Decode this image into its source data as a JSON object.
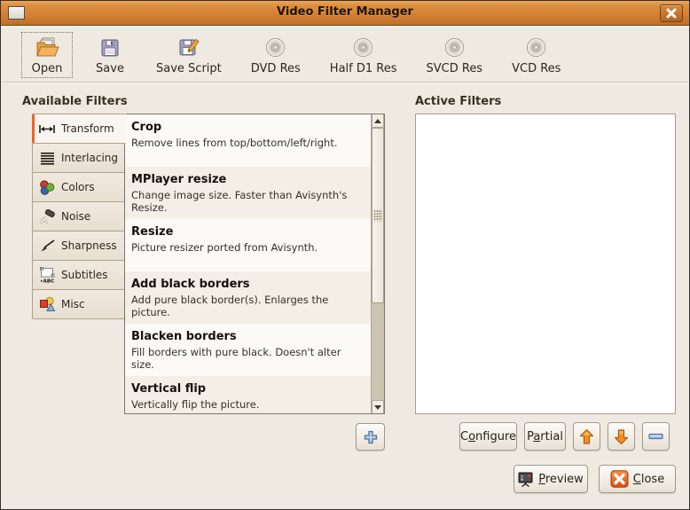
{
  "window": {
    "title": "Video Filter Manager",
    "icon": "window-shade-icon",
    "close_icon": "close-x-icon"
  },
  "toolbar": {
    "items": [
      {
        "label": "Open",
        "icon": "open-folder-icon",
        "focused": true
      },
      {
        "label": "Save",
        "icon": "floppy-disk-icon"
      },
      {
        "label": "Save Script",
        "icon": "floppy-pencil-icon"
      },
      {
        "label": "DVD Res",
        "icon": "disc-icon"
      },
      {
        "label": "Half D1 Res",
        "icon": "disc-icon"
      },
      {
        "label": "SVCD Res",
        "icon": "disc-icon"
      },
      {
        "label": "VCD Res",
        "icon": "disc-icon"
      }
    ]
  },
  "available": {
    "heading": "Available Filters",
    "tabs": [
      {
        "label": "Transform",
        "icon": "transform-icon",
        "selected": true
      },
      {
        "label": "Interlacing",
        "icon": "interlacing-icon"
      },
      {
        "label": "Colors",
        "icon": "colors-icon"
      },
      {
        "label": "Noise",
        "icon": "noise-icon"
      },
      {
        "label": "Sharpness",
        "icon": "sharpness-icon"
      },
      {
        "label": "Subtitles",
        "icon": "subtitles-icon"
      },
      {
        "label": "Misc",
        "icon": "misc-icon"
      }
    ],
    "filters": [
      {
        "name": "Crop",
        "desc": "Remove lines from top/bottom/left/right."
      },
      {
        "name": "MPlayer resize",
        "desc": "Change image size. Faster than Avisynth's Resize."
      },
      {
        "name": "Resize",
        "desc": "Picture resizer ported from Avisynth."
      },
      {
        "name": "Add black borders",
        "desc": "Add pure black border(s). Enlarges the picture."
      },
      {
        "name": "Blacken borders",
        "desc": "Fill borders with pure black. Doesn't alter size."
      },
      {
        "name": "Vertical flip",
        "desc": "Vertically flip the picture."
      }
    ]
  },
  "active": {
    "heading": "Active Filters",
    "items": []
  },
  "buttons": {
    "add_icon": "plus-icon",
    "configure": {
      "pre": "C",
      "mn": "o",
      "post": "nfigure"
    },
    "partial": {
      "pre": "P",
      "mn": "a",
      "post": "rtial"
    },
    "up_icon": "up-arrow-icon",
    "down_icon": "down-arrow-icon",
    "remove_icon": "minus-icon",
    "preview": {
      "pre": "",
      "mn": "P",
      "post": "review"
    },
    "close": {
      "pre": "",
      "mn": "C",
      "post": "lose"
    }
  },
  "colors": {
    "titlebar_top": "#E59A4A",
    "titlebar_bottom": "#BE6E28",
    "window_bg": "#EFEAE1",
    "selected_tab_accent": "#EE6425",
    "arrow_orange": "#F57900",
    "icon_blue": "#5C80AB",
    "close_icon_orange": "#E85513"
  }
}
